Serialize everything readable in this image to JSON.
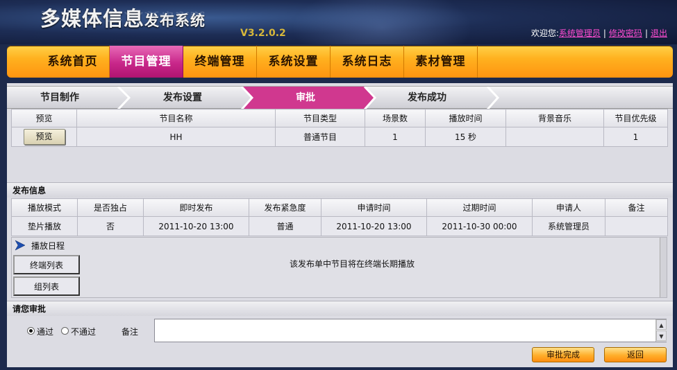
{
  "header": {
    "title_main": "多媒体信息",
    "title_sub": "发布系统",
    "version": "V3.2.0.2",
    "welcome": "欢迎您:",
    "user": "系统管理员",
    "change_password": "修改密码",
    "logout": "退出",
    "separator": "|"
  },
  "nav": {
    "items": [
      "系统首页",
      "节目管理",
      "终端管理",
      "系统设置",
      "系统日志",
      "素材管理"
    ],
    "active_index": 1
  },
  "steps": {
    "items": [
      "节目制作",
      "发布设置",
      "审批",
      "发布成功"
    ],
    "active_index": 2
  },
  "program_table": {
    "headers": [
      "预览",
      "节目名称",
      "节目类型",
      "场景数",
      "播放时间",
      "背景音乐",
      "节目优先级"
    ],
    "row": {
      "preview_button": "预览",
      "name": "HH",
      "type": "普通节目",
      "scenes": "1",
      "duration": "15 秒",
      "music": "",
      "priority": "1"
    }
  },
  "publish_info": {
    "title": "发布信息",
    "headers": [
      "播放模式",
      "是否独占",
      "即时发布",
      "发布紧急度",
      "申请时间",
      "过期时间",
      "申请人",
      "备注"
    ],
    "row": [
      "垫片播放",
      "否",
      "2011-10-20 13:00",
      "普通",
      "2011-10-20 13:00",
      "2011-10-30 00:00",
      "系统管理员",
      ""
    ]
  },
  "schedule": {
    "title": "播放日程",
    "tabs": [
      "终端列表",
      "组列表"
    ],
    "message": "该发布单中节目将在终端长期播放"
  },
  "approval": {
    "title": "请您审批",
    "options": [
      "通过",
      "不通过"
    ],
    "selected_index": 0,
    "remark_label": "备注",
    "remark_value": "",
    "submit_button": "审批完成",
    "back_button": "返回"
  },
  "colors": {
    "nav_orange": "#ffb11f",
    "active_pink": "#c8278a",
    "link_pink": "#ff4cd2",
    "version_gold": "#d8b83a"
  }
}
